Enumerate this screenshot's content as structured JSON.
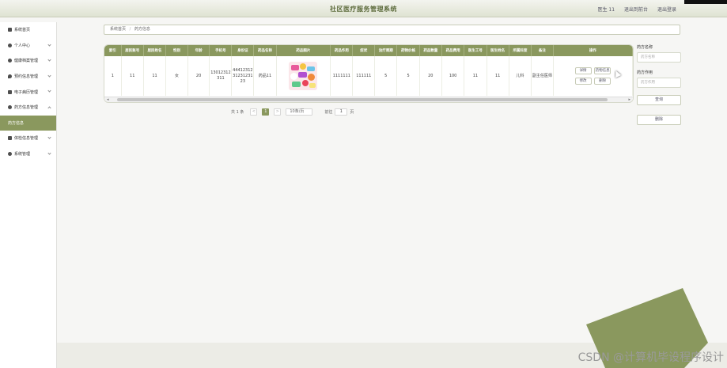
{
  "header": {
    "title": "社区医疗服务管理系统",
    "user_label": "医生 11",
    "back_label": "退出到前台",
    "logout_label": "退出登录"
  },
  "sidebar": {
    "items": [
      {
        "label": "系统首页",
        "icon": "home-icon",
        "has_children": false,
        "active": false
      },
      {
        "label": "个人中心",
        "icon": "user-icon",
        "has_children": true,
        "active": false
      },
      {
        "label": "健康档案管理",
        "icon": "user-icon",
        "has_children": true,
        "active": false
      },
      {
        "label": "预约信息管理",
        "icon": "pin-icon",
        "has_children": true,
        "active": false
      },
      {
        "label": "电子病历管理",
        "icon": "document-icon",
        "has_children": true,
        "active": false
      },
      {
        "label": "药方信息管理",
        "icon": "user-icon",
        "has_children": true,
        "active": false
      },
      {
        "label": "药方信息",
        "icon": "",
        "has_children": false,
        "active": true
      },
      {
        "label": "体检信息管理",
        "icon": "monitor-icon",
        "has_children": true,
        "active": false
      },
      {
        "label": "系统管理",
        "icon": "gear-icon",
        "has_children": true,
        "active": false
      }
    ]
  },
  "breadcrumb": {
    "home": "系统首页",
    "separator": "/",
    "current": "药方信息"
  },
  "table": {
    "columns": [
      "索引",
      "居民账号",
      "居民姓名",
      "性别",
      "年龄",
      "手机号",
      "身份证",
      "药品名称",
      "药品图片",
      "药品作用",
      "症状",
      "治疗周期",
      "药物价格",
      "药品数量",
      "药品费用",
      "医生工号",
      "医生姓名",
      "所属科室",
      "备注",
      "操作"
    ],
    "rows": [
      {
        "index": "1",
        "account": "11",
        "name": "11",
        "gender": "女",
        "age": "20",
        "phone": "13012312311",
        "id_card": "444123123123123123",
        "drug_name": "药品11",
        "drug_effect": "1111111",
        "symptom": "111111",
        "cycle": "5",
        "price": "5",
        "quantity": "20",
        "cost": "100",
        "doctor_no": "11",
        "doctor_name": "11",
        "department": "儿科",
        "remark": "副主任医师"
      }
    ],
    "actions": {
      "detail": "详情",
      "drug_detail": "药物信息",
      "edit": "修改",
      "delete": "删除"
    }
  },
  "pagination": {
    "total": "共 1 条",
    "prev": "<",
    "current_page": "1",
    "next": ">",
    "page_size": "10条/页",
    "goto_prefix": "前往",
    "goto_value": "1",
    "goto_suffix": "页"
  },
  "search": {
    "drug_label": "药方名称",
    "drug_placeholder": "药方名称",
    "effect_label": "药方作用",
    "effect_placeholder": "药方作用",
    "query_btn": "查询",
    "delete_btn": "删除"
  },
  "watermark": "CSDN @计算机毕设程序设计",
  "colors": {
    "accent": "#8a985e",
    "title": "#5d6b3c"
  }
}
